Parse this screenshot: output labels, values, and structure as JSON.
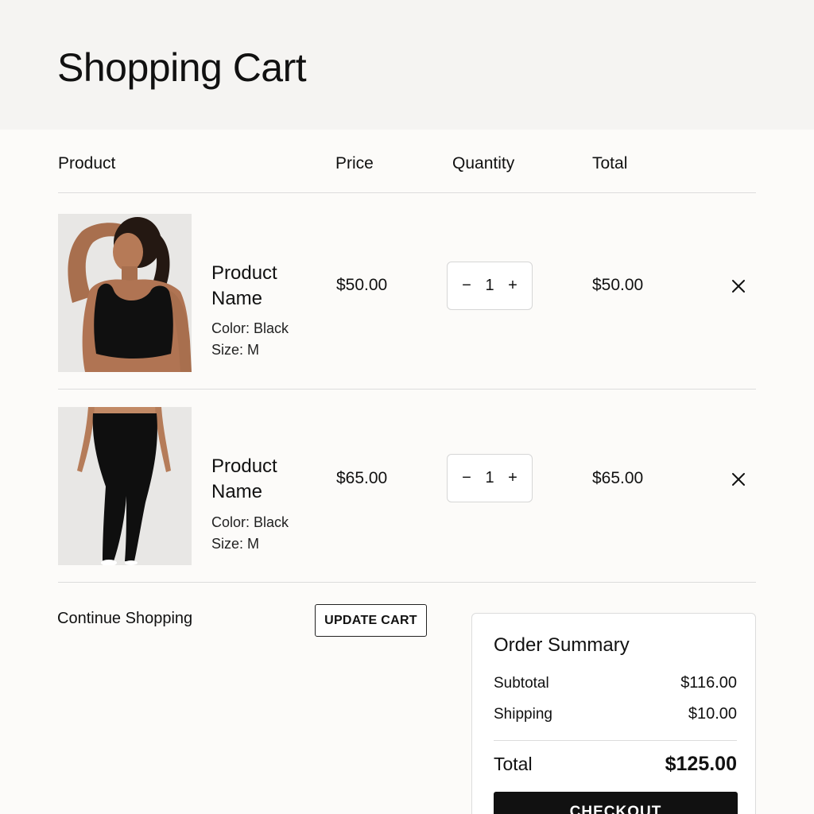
{
  "header": {
    "title": "Shopping Cart"
  },
  "columns": {
    "product": "Product",
    "price": "Price",
    "quantity": "Quantity",
    "total": "Total"
  },
  "items": [
    {
      "name": "Product Name",
      "color": "Color: Black",
      "size": "Size: M",
      "price": "$50.00",
      "quantity": "1",
      "total": "$50.00",
      "image": "woman-in-black-sports-bra"
    },
    {
      "name": "Product Name",
      "color": "Color: Black",
      "size": "Size: M",
      "price": "$65.00",
      "quantity": "1",
      "total": "$65.00",
      "image": "black-leggings"
    }
  ],
  "stepper": {
    "decrement": "−",
    "increment": "+"
  },
  "actions": {
    "continue": "Continue Shopping",
    "update": "UPDATE CART"
  },
  "summary": {
    "title": "Order Summary",
    "subtotal_label": "Subtotal",
    "subtotal_value": "$116.00",
    "shipping_label": "Shipping",
    "shipping_value": "$10.00",
    "total_label": "Total",
    "total_value": "$125.00",
    "checkout_label": "CHECKOUT"
  },
  "colors": {
    "accent": "#111111",
    "background": "#fcfbf9",
    "header_bg": "#f5f4f2",
    "border": "#dcdcdc"
  }
}
